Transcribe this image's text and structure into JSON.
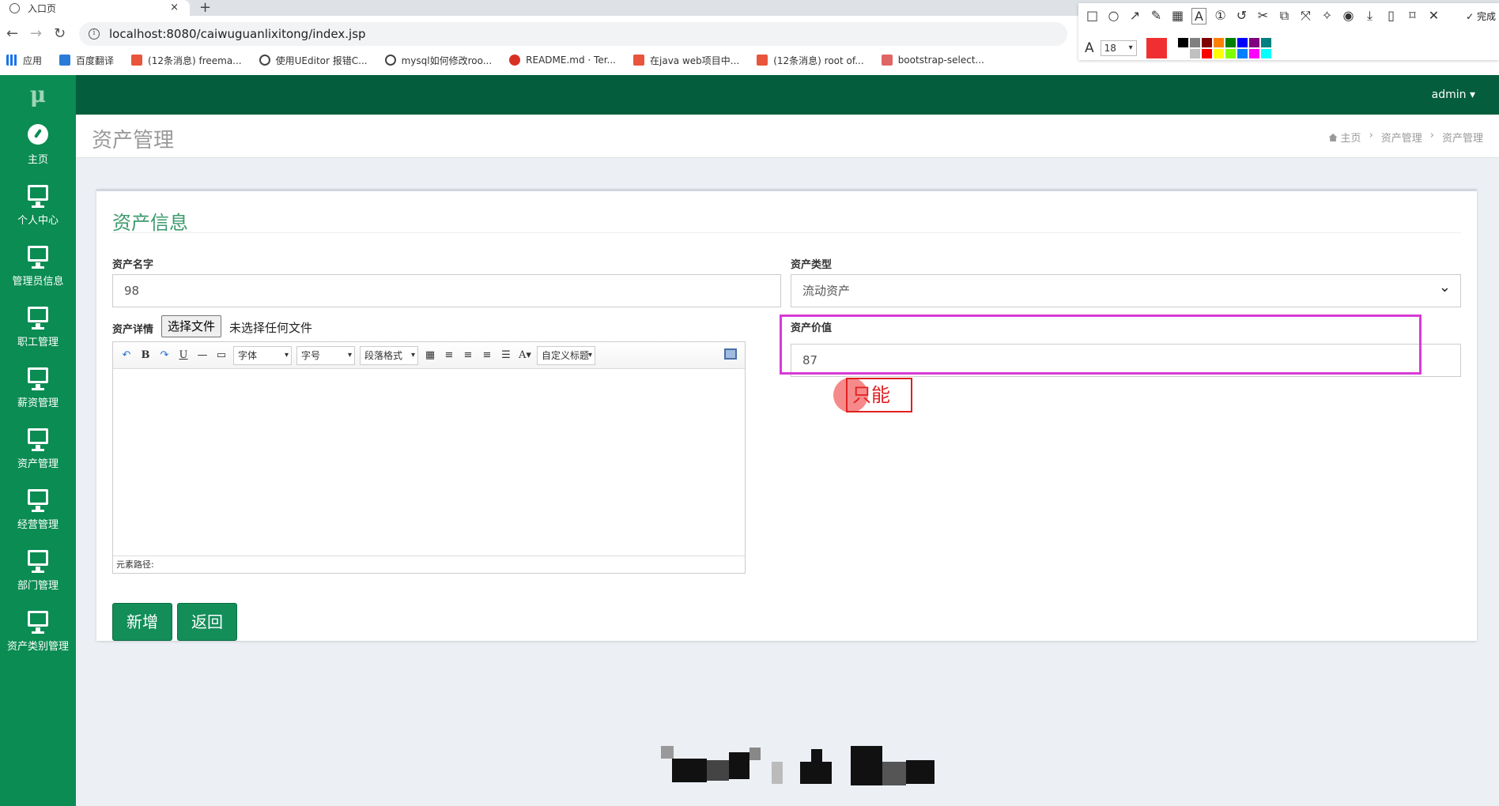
{
  "browser": {
    "tab_title": "入口页",
    "tab_close": "×",
    "new_tab": "+",
    "url": "localhost:8080/caiwuguanlixitong/index.jsp",
    "bookmarks": [
      {
        "icon": "apps-icon",
        "label": "应用"
      },
      {
        "icon": "translate-icon",
        "label": "百度翻译"
      },
      {
        "icon": "csdn-icon",
        "label": "(12条消息) freema..."
      },
      {
        "icon": "github-icon",
        "label": "使用UEditor 报错C..."
      },
      {
        "icon": "github-icon",
        "label": "mysql如何修改roo..."
      },
      {
        "icon": "gitee-icon",
        "label": "README.md · Ter..."
      },
      {
        "icon": "csdn-icon",
        "label": "在java web项目中..."
      },
      {
        "icon": "csdn-icon",
        "label": "(12条消息) root of..."
      },
      {
        "icon": "jianshu-icon",
        "label": "bootstrap-select..."
      }
    ]
  },
  "snip_toolbar": {
    "done_label": "完成",
    "font_size": "18",
    "current_color": "#f03030",
    "swatches": [
      "#000000",
      "#808080",
      "#800000",
      "#ff8000",
      "#008000",
      "#0000ff",
      "#800080",
      "#008080",
      "#ffffff",
      "#c0c0c0",
      "#ff0000",
      "#ffff00",
      "#80ff00",
      "#0080ff",
      "#ff00ff",
      "#00ffff"
    ]
  },
  "app": {
    "logo": "μ",
    "user_menu": "admin ▾",
    "sidebar": [
      {
        "icon": "dashboard-icon",
        "label": "主页"
      },
      {
        "icon": "monitor-icon",
        "label": "个人中心"
      },
      {
        "icon": "monitor-icon",
        "label": "管理员信息"
      },
      {
        "icon": "monitor-icon",
        "label": "职工管理"
      },
      {
        "icon": "monitor-icon",
        "label": "薪资管理"
      },
      {
        "icon": "monitor-icon",
        "label": "资产管理"
      },
      {
        "icon": "monitor-icon",
        "label": "经营管理"
      },
      {
        "icon": "monitor-icon",
        "label": "部门管理"
      },
      {
        "icon": "monitor-icon",
        "label": "资产类别管理"
      }
    ],
    "page_title": "资产管理",
    "breadcrumb": [
      "主页",
      "资产管理",
      "资产管理"
    ],
    "breadcrumb_sep": "›",
    "form": {
      "title": "资产信息",
      "name_label": "资产名字",
      "name_value": "98",
      "type_label": "资产类型",
      "type_value": "流动资产",
      "detail_label": "资产详情",
      "file_button": "选择文件",
      "file_status": "未选择任何文件",
      "value_label": "资产价值",
      "value_value": "87",
      "editor": {
        "font_family": "字体",
        "font_size": "字号",
        "paragraph": "段落格式",
        "custom_title": "自定义标题",
        "element_path": "元素路径:"
      },
      "add_button": "新增",
      "back_button": "返回"
    },
    "annotation_text": "只能"
  },
  "colors": {
    "topbar": "#045d3c",
    "sidebar": "#0a8c52",
    "button": "#138e59",
    "highlight_box": "#d83ad8",
    "annotation": "#e02020"
  }
}
